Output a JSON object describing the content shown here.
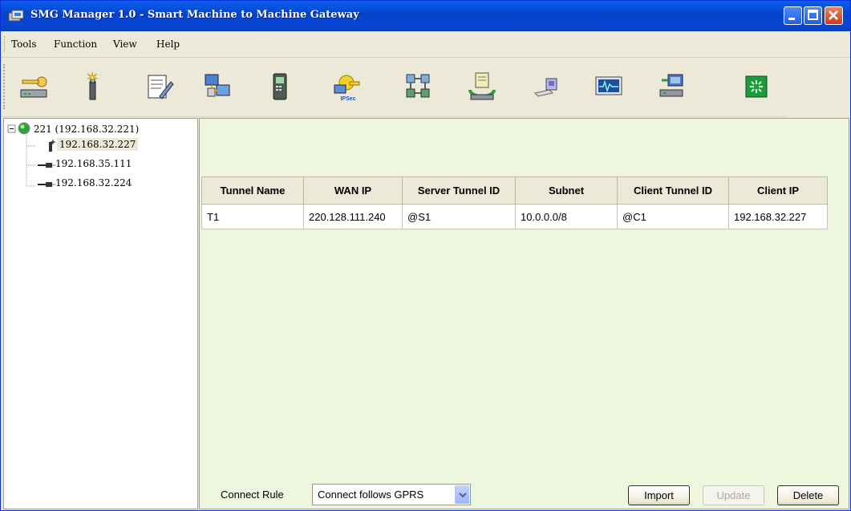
{
  "window": {
    "title": "SMG Manager 1.0 - Smart Machine to Machine Gateway"
  },
  "menu": {
    "items": [
      "Tools",
      "Function",
      "View",
      "Help"
    ]
  },
  "toolbar": {
    "icons": [
      "key-router-icon",
      "wand-icon",
      "edit-notepad-icon",
      "network-computers-icon",
      "mobile-phone-icon",
      "ipsec-icon",
      "network-grid-icon",
      "refresh-server-icon",
      "usb-device-icon",
      "monitor-wave-icon",
      "network-pc-icon",
      "green-status-icon"
    ],
    "ipsec_label": "IPSec"
  },
  "tree": {
    "root": "221 (192.168.32.221)",
    "children": [
      "192.168.32.227",
      "192.168.35.111",
      "192.168.32.224"
    ]
  },
  "table": {
    "headers": [
      "Tunnel Name",
      "WAN IP",
      "Server Tunnel ID",
      "Subnet",
      "Client Tunnel ID",
      "Client IP"
    ],
    "rows": [
      [
        "T1",
        "220.128.111.240",
        "@S1",
        "10.0.0.0/8",
        "@C1",
        "192.168.32.227"
      ]
    ]
  },
  "footer": {
    "connect_rule_label": "Connect Rule",
    "connect_rule_value": "Connect follows GPRS",
    "import_label": "Import",
    "update_label": "Update",
    "delete_label": "Delete"
  },
  "colors": {
    "titlebar": "#0543c9",
    "panel_bg": "#eef7de",
    "window_bg": "#ece9d8"
  }
}
